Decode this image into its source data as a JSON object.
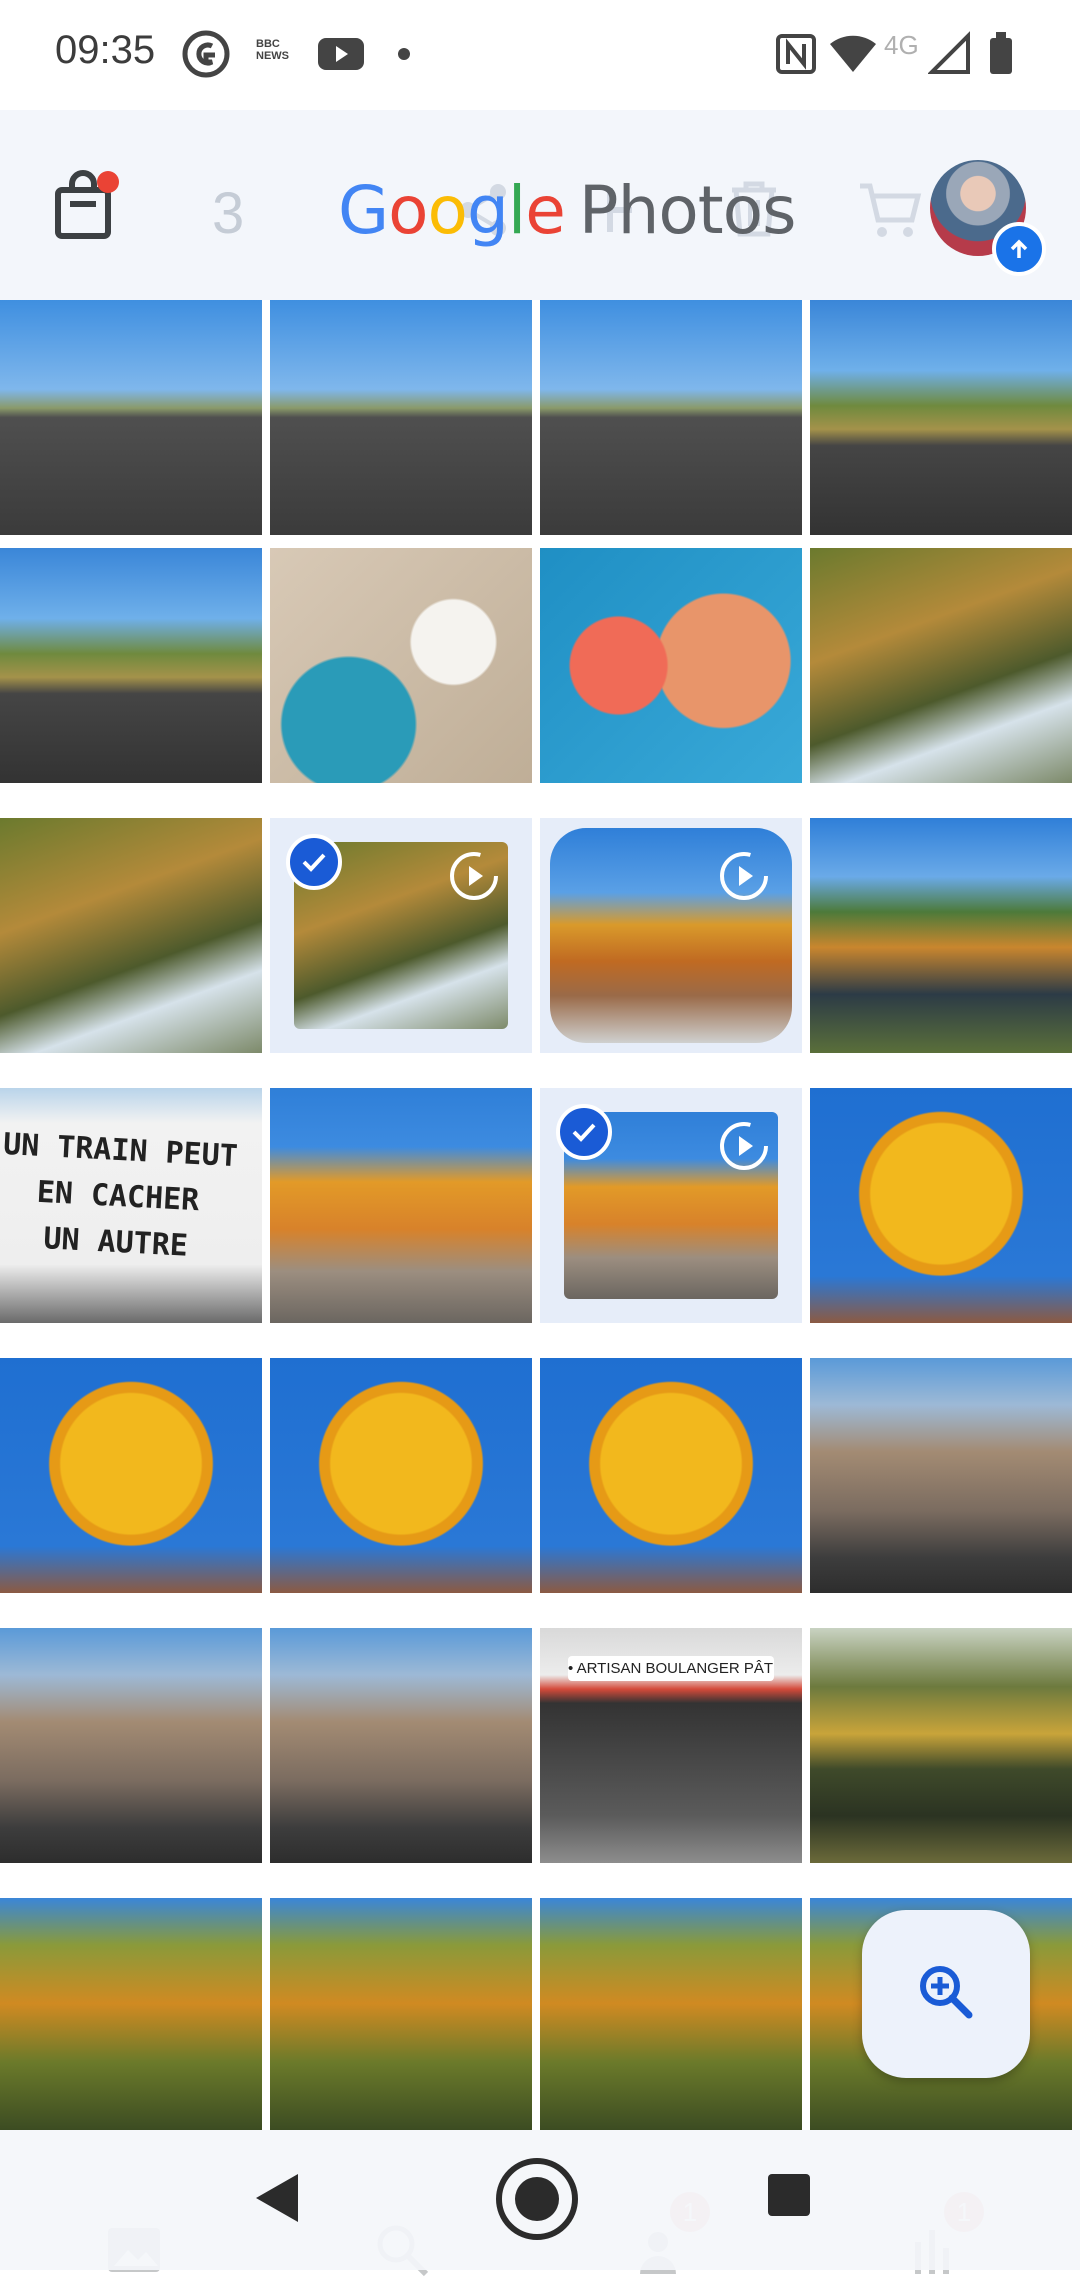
{
  "status_bar": {
    "time": "09:35",
    "left_icons": [
      "grammarly-icon",
      "bbc-news-icon",
      "youtube-icon",
      "dot-icon"
    ],
    "right_icons": [
      "nfc-icon",
      "wifi-icon",
      "4g-icon",
      "signal-icon",
      "battery-icon"
    ],
    "network_label": "4G",
    "bbc_label": "BBC NEWS"
  },
  "app_bar": {
    "logo_google": "Google",
    "logo_photos": "Photos",
    "selected_count": "3",
    "icons": [
      "shopping-bag-icon",
      "share-icon",
      "add-icon",
      "delete-icon",
      "cart-icon"
    ],
    "notification_dot_color": "#ea4335"
  },
  "grid": {
    "rows": [
      [
        {
          "type": "photo",
          "theme": "highway"
        },
        {
          "type": "photo",
          "theme": "highway"
        },
        {
          "type": "photo",
          "theme": "highway"
        },
        {
          "type": "photo",
          "theme": "highway-hill"
        }
      ],
      [
        {
          "type": "photo",
          "theme": "highway-hill"
        },
        {
          "type": "photo",
          "theme": "coffee"
        },
        {
          "type": "photo",
          "theme": "macarons"
        },
        {
          "type": "photo",
          "theme": "river-trees"
        }
      ],
      [
        {
          "type": "photo",
          "theme": "river-trees"
        },
        {
          "type": "video",
          "theme": "river-trees",
          "selected": true
        },
        {
          "type": "video",
          "theme": "autumn-kiosk",
          "selected": false
        },
        {
          "type": "photo",
          "theme": "river-valley"
        }
      ],
      [
        {
          "type": "photo",
          "theme": "sign"
        },
        {
          "type": "photo",
          "theme": "autumn-street"
        },
        {
          "type": "video",
          "theme": "autumn-street",
          "selected": true
        },
        {
          "type": "photo",
          "theme": "yellow-tree"
        }
      ],
      [
        {
          "type": "photo",
          "theme": "yellow-tree"
        },
        {
          "type": "photo",
          "theme": "yellow-tree"
        },
        {
          "type": "photo",
          "theme": "yellow-tree"
        },
        {
          "type": "photo",
          "theme": "town-street"
        }
      ],
      [
        {
          "type": "photo",
          "theme": "town-street"
        },
        {
          "type": "photo",
          "theme": "town-street"
        },
        {
          "type": "photo",
          "theme": "bakery"
        },
        {
          "type": "photo",
          "theme": "lake-trees"
        }
      ],
      [
        {
          "type": "photo",
          "theme": "autumn-park"
        },
        {
          "type": "photo",
          "theme": "autumn-park"
        },
        {
          "type": "photo",
          "theme": "autumn-park"
        },
        {
          "type": "photo",
          "theme": "autumn-park"
        }
      ]
    ],
    "sign_text": [
      "UN TRAIN PEUT",
      "EN CACHER",
      "UN AUTRE"
    ],
    "bakery_text": "• ARTISAN BOULANGER PÂTISSIER •"
  },
  "fab": {
    "icon": "zoom-in-icon"
  },
  "bottom_nav": {
    "items": [
      "photos-icon",
      "search-icon",
      "sharing-icon",
      "library-icon"
    ],
    "badges": [
      "1",
      "1"
    ]
  },
  "system_nav": {
    "buttons": [
      "back-icon",
      "home-icon",
      "recents-icon"
    ]
  },
  "colors": {
    "accent": "#1a73e8",
    "selection": "#e6edf9",
    "check": "#1a5bd6"
  }
}
